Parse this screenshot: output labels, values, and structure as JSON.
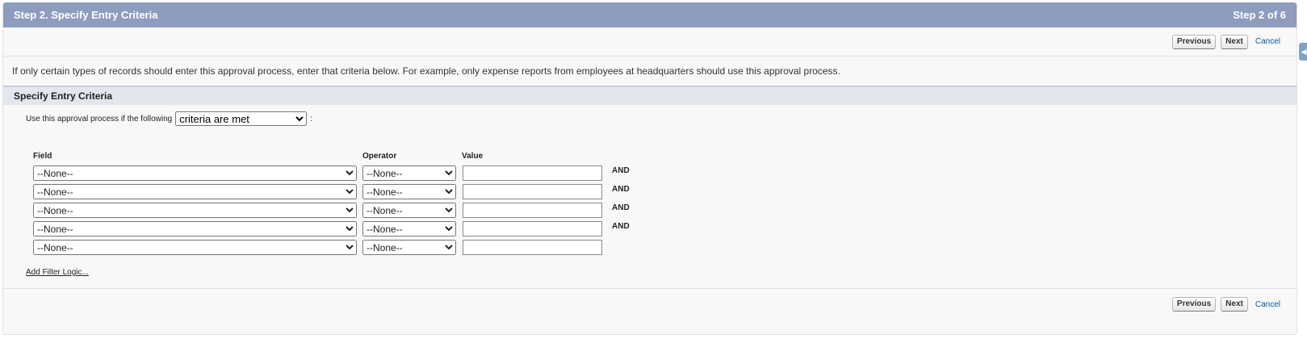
{
  "header": {
    "title": "Step 2. Specify Entry Criteria",
    "step": "Step 2 of 6"
  },
  "buttons": {
    "previous": "Previous",
    "next": "Next",
    "cancel": "Cancel"
  },
  "intro_text": "If only certain types of records should enter this approval process, enter that criteria below. For example, only expense reports from employees at headquarters should use this approval process.",
  "section": {
    "title": "Specify Entry Criteria"
  },
  "criteria": {
    "label": "Use this approval process if the following",
    "selected": "criteria are met",
    "colon": ":"
  },
  "columns": {
    "field": "Field",
    "operator": "Operator",
    "value": "Value"
  },
  "rows": [
    {
      "field": "--None--",
      "operator": "--None--",
      "value": "",
      "connector": "AND"
    },
    {
      "field": "--None--",
      "operator": "--None--",
      "value": "",
      "connector": "AND"
    },
    {
      "field": "--None--",
      "operator": "--None--",
      "value": "",
      "connector": "AND"
    },
    {
      "field": "--None--",
      "operator": "--None--",
      "value": "",
      "connector": "AND"
    },
    {
      "field": "--None--",
      "operator": "--None--",
      "value": "",
      "connector": ""
    }
  ],
  "filter_logic_link": "Add Filter Logic...",
  "side_tab_icon": "chevron-left-icon"
}
